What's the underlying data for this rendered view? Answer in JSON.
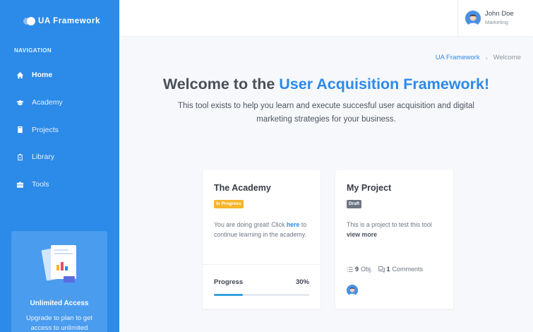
{
  "brand": {
    "name": "UA Framework"
  },
  "sidebar": {
    "heading": "NAVIGATION",
    "items": [
      {
        "label": "Home",
        "icon": "home-icon"
      },
      {
        "label": "Academy",
        "icon": "graduation-cap-icon"
      },
      {
        "label": "Projects",
        "icon": "book-icon"
      },
      {
        "label": "Library",
        "icon": "clipboard-icon"
      },
      {
        "label": "Tools",
        "icon": "toolbox-icon"
      }
    ],
    "promo": {
      "title": "Unlimited Access",
      "text": "Upgrade to plan to get access to unlimited"
    }
  },
  "user": {
    "name": "John Doe",
    "role": "Marketing"
  },
  "breadcrumb": {
    "root": "UA Framework",
    "separator": "›",
    "current": "Welcome"
  },
  "hero": {
    "title_prefix": "Welcome to the ",
    "title_accent": "User Acquisition Framework!",
    "subtitle": "This tool exists to help you learn and execute succesful user acquisition and digital marketing strategies for your business."
  },
  "cards": {
    "academy": {
      "title": "The Academy",
      "badge": "In Progress",
      "text_before": "You are doing great! Click ",
      "link": "here",
      "text_after": " to continue learning in the academy.",
      "progress_label": "Progress",
      "progress_value": "30%",
      "progress_fraction": 0.3
    },
    "project": {
      "title": "My Project",
      "badge": "Draft",
      "description": "This is a project to test this tool",
      "more": "view more",
      "objectives_count": "9",
      "objectives_label": "Obj.",
      "comments_count": "1",
      "comments_label": "Comments"
    }
  },
  "colors": {
    "sidebar": "#2c8ae8",
    "accent": "#2c8ae8",
    "badge_in_progress": "#f6b52a",
    "badge_draft": "#6c7580",
    "progress_fill": "#37a2de"
  }
}
